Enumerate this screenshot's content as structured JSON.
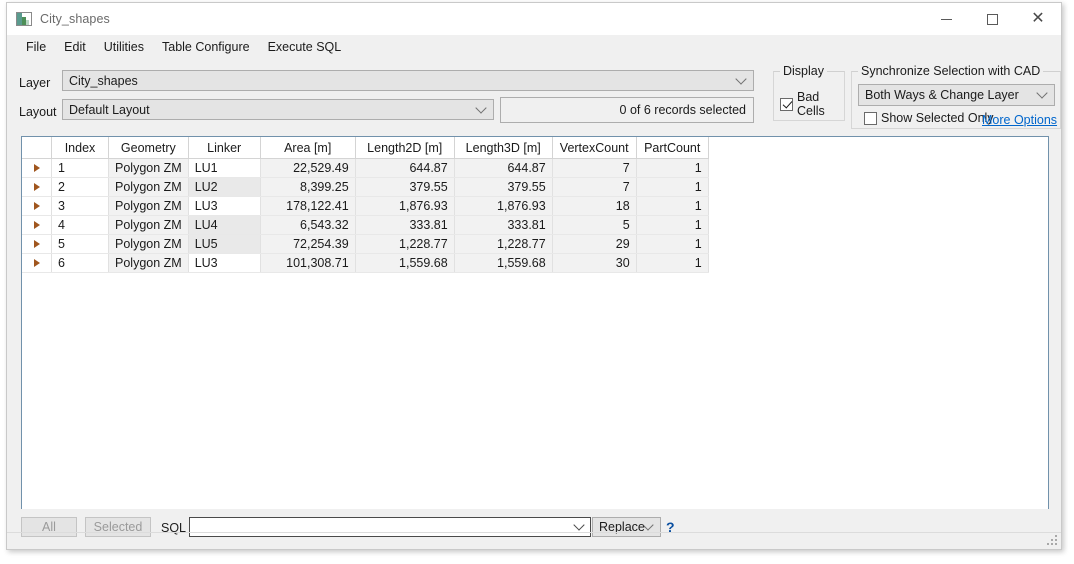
{
  "window": {
    "title": "City_shapes",
    "icon": "image-thumbnail-icon",
    "minimize_label": "–",
    "maximize_label": "☐",
    "close_label": "✕"
  },
  "menubar": {
    "items": [
      {
        "label": "File"
      },
      {
        "label": "Edit"
      },
      {
        "label": "Utilities"
      },
      {
        "label": "Table Configure"
      },
      {
        "label": "Execute SQL"
      }
    ]
  },
  "toolbar": {
    "layer_label": "Layer",
    "layer_value": "City_shapes",
    "layout_label": "Layout",
    "layout_value": "Default Layout",
    "records_status": "0 of 6 records selected"
  },
  "display_group": {
    "title": "Display",
    "bad_cells_label": "Bad Cells",
    "bad_cells_checked": true
  },
  "sync_group": {
    "title": "Synchronize Selection with CAD",
    "mode_value": "Both Ways & Change Layer",
    "show_selected_only_label": "Show Selected Only",
    "show_selected_only_checked": false,
    "more_options_label": "More Options"
  },
  "table": {
    "columns": [
      {
        "key": "index",
        "label": "Index",
        "align": "left"
      },
      {
        "key": "geometry",
        "label": "Geometry",
        "align": "left"
      },
      {
        "key": "linker",
        "label": "Linker",
        "align": "left"
      },
      {
        "key": "area",
        "label": "Area [m]",
        "align": "right"
      },
      {
        "key": "length2d",
        "label": "Length2D [m]",
        "align": "right"
      },
      {
        "key": "length3d",
        "label": "Length3D [m]",
        "align": "right"
      },
      {
        "key": "vertexcount",
        "label": "VertexCount",
        "align": "right"
      },
      {
        "key": "partcount",
        "label": "PartCount",
        "align": "right"
      }
    ],
    "rows": [
      {
        "index": "1",
        "geometry": "Polygon ZM",
        "linker": "LU1",
        "area": "22,529.49",
        "length2d": "644.87",
        "length3d": "644.87",
        "vertexcount": "7",
        "partcount": "1",
        "linker_alt": false
      },
      {
        "index": "2",
        "geometry": "Polygon ZM",
        "linker": "LU2",
        "area": "8,399.25",
        "length2d": "379.55",
        "length3d": "379.55",
        "vertexcount": "7",
        "partcount": "1",
        "linker_alt": true
      },
      {
        "index": "3",
        "geometry": "Polygon ZM",
        "linker": "LU3",
        "area": "178,122.41",
        "length2d": "1,876.93",
        "length3d": "1,876.93",
        "vertexcount": "18",
        "partcount": "1",
        "linker_alt": false
      },
      {
        "index": "4",
        "geometry": "Polygon ZM",
        "linker": "LU4",
        "area": "6,543.32",
        "length2d": "333.81",
        "length3d": "333.81",
        "vertexcount": "5",
        "partcount": "1",
        "linker_alt": true
      },
      {
        "index": "5",
        "geometry": "Polygon ZM",
        "linker": "LU5",
        "area": "72,254.39",
        "length2d": "1,228.77",
        "length3d": "1,228.77",
        "vertexcount": "29",
        "partcount": "1",
        "linker_alt": true
      },
      {
        "index": "6",
        "geometry": "Polygon ZM",
        "linker": "LU3",
        "area": "101,308.71",
        "length2d": "1,559.68",
        "length3d": "1,559.68",
        "vertexcount": "30",
        "partcount": "1",
        "linker_alt": false
      }
    ]
  },
  "bottombar": {
    "all_label": "All",
    "selected_label": "Selected",
    "sql_label": "SQL",
    "sql_value": "",
    "mode_value": "Replace",
    "help_label": "?"
  },
  "colors": {
    "grid_border": "#7191ab",
    "link": "#0066cc",
    "row_arrow": "#a0561e",
    "window_bg": "#f0f0f0"
  }
}
